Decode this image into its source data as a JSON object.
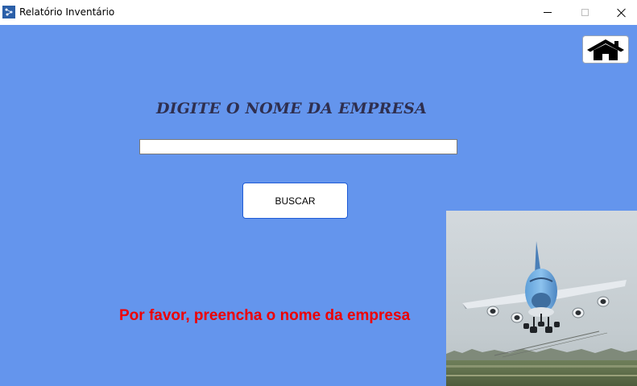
{
  "window": {
    "title": "Relatório Inventário",
    "icon": "app-icon",
    "controls": [
      "minimize",
      "maximize",
      "close"
    ]
  },
  "toolbar": {
    "home_icon": "home-icon"
  },
  "form": {
    "heading": "DIGITE O NOME DA EMPRESA",
    "company_input_value": "",
    "company_input_placeholder": "",
    "search_label": "BUSCAR",
    "error_message": "Por favor, preencha o nome da empresa"
  },
  "image": {
    "subject": "airplane landing photo"
  },
  "colors": {
    "background": "#6495ed",
    "error": "#ee0000",
    "heading": "#2f2f4f",
    "button_border": "#1e5bd6"
  }
}
